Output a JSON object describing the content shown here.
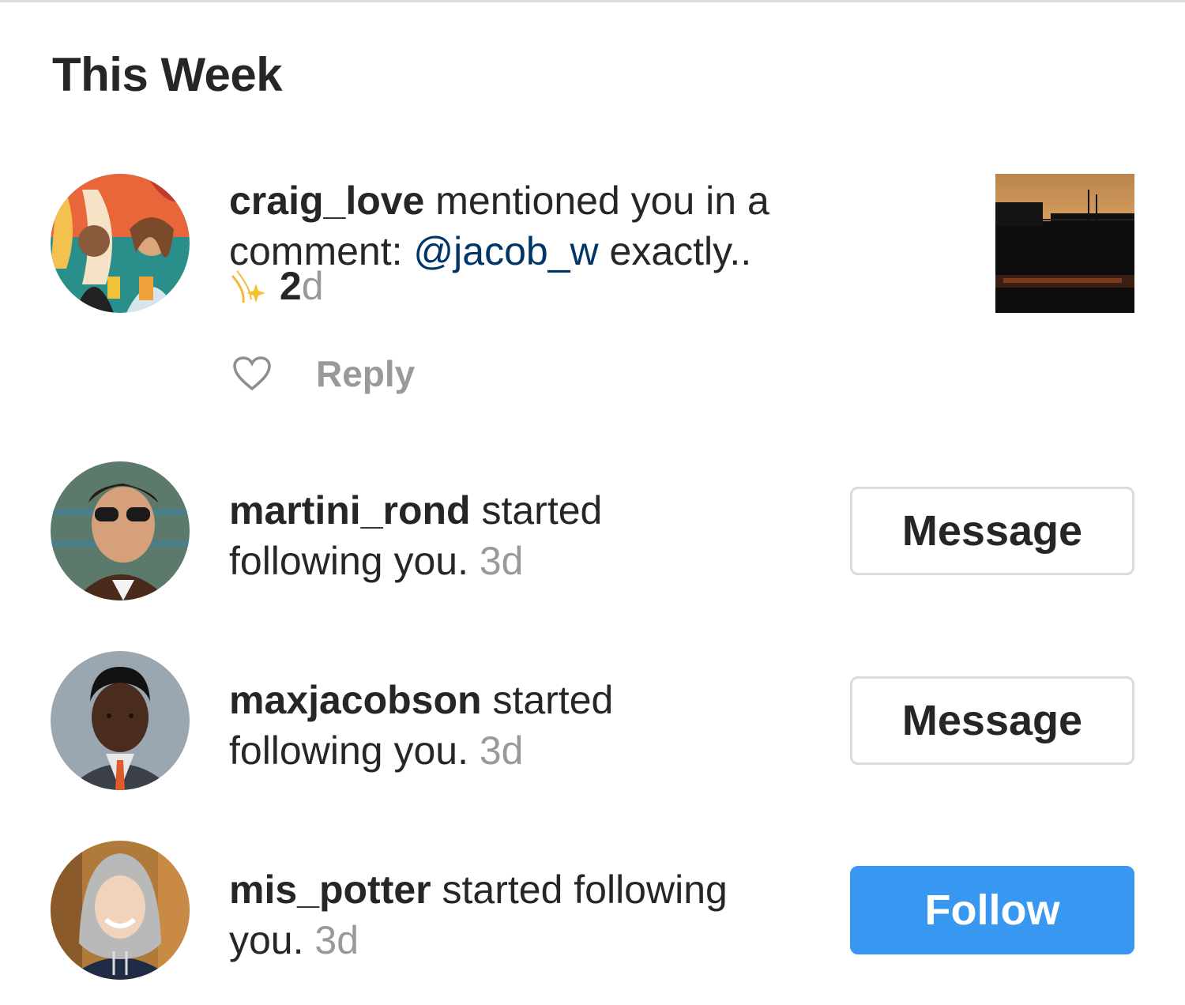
{
  "section": {
    "title": "This Week"
  },
  "notifications": [
    {
      "username": "craig_love",
      "line1_rest": " mentioned you in a",
      "line2_prefix": "comment: ",
      "mention": "@jacob_w",
      "line2_suffix": " exactly..",
      "time_bold": "2",
      "time_rest": "d",
      "reply_label": "Reply"
    },
    {
      "username": "martini_rond",
      "line1_rest": " started",
      "line2": "following you. ",
      "time": "3d",
      "button_label": "Message"
    },
    {
      "username": "maxjacobson",
      "line1_rest": " started",
      "line2": "following you. ",
      "time": "3d",
      "button_label": "Message"
    },
    {
      "username": "mis_potter",
      "line1_rest": " started following",
      "line2": "you. ",
      "time": "3d",
      "button_label": "Follow"
    }
  ],
  "colors": {
    "accent": "#3897f0",
    "mention": "#003569",
    "muted": "#999999",
    "border": "#dbdbdb"
  },
  "icons": [
    "heart-icon",
    "sparkle-emoji"
  ]
}
